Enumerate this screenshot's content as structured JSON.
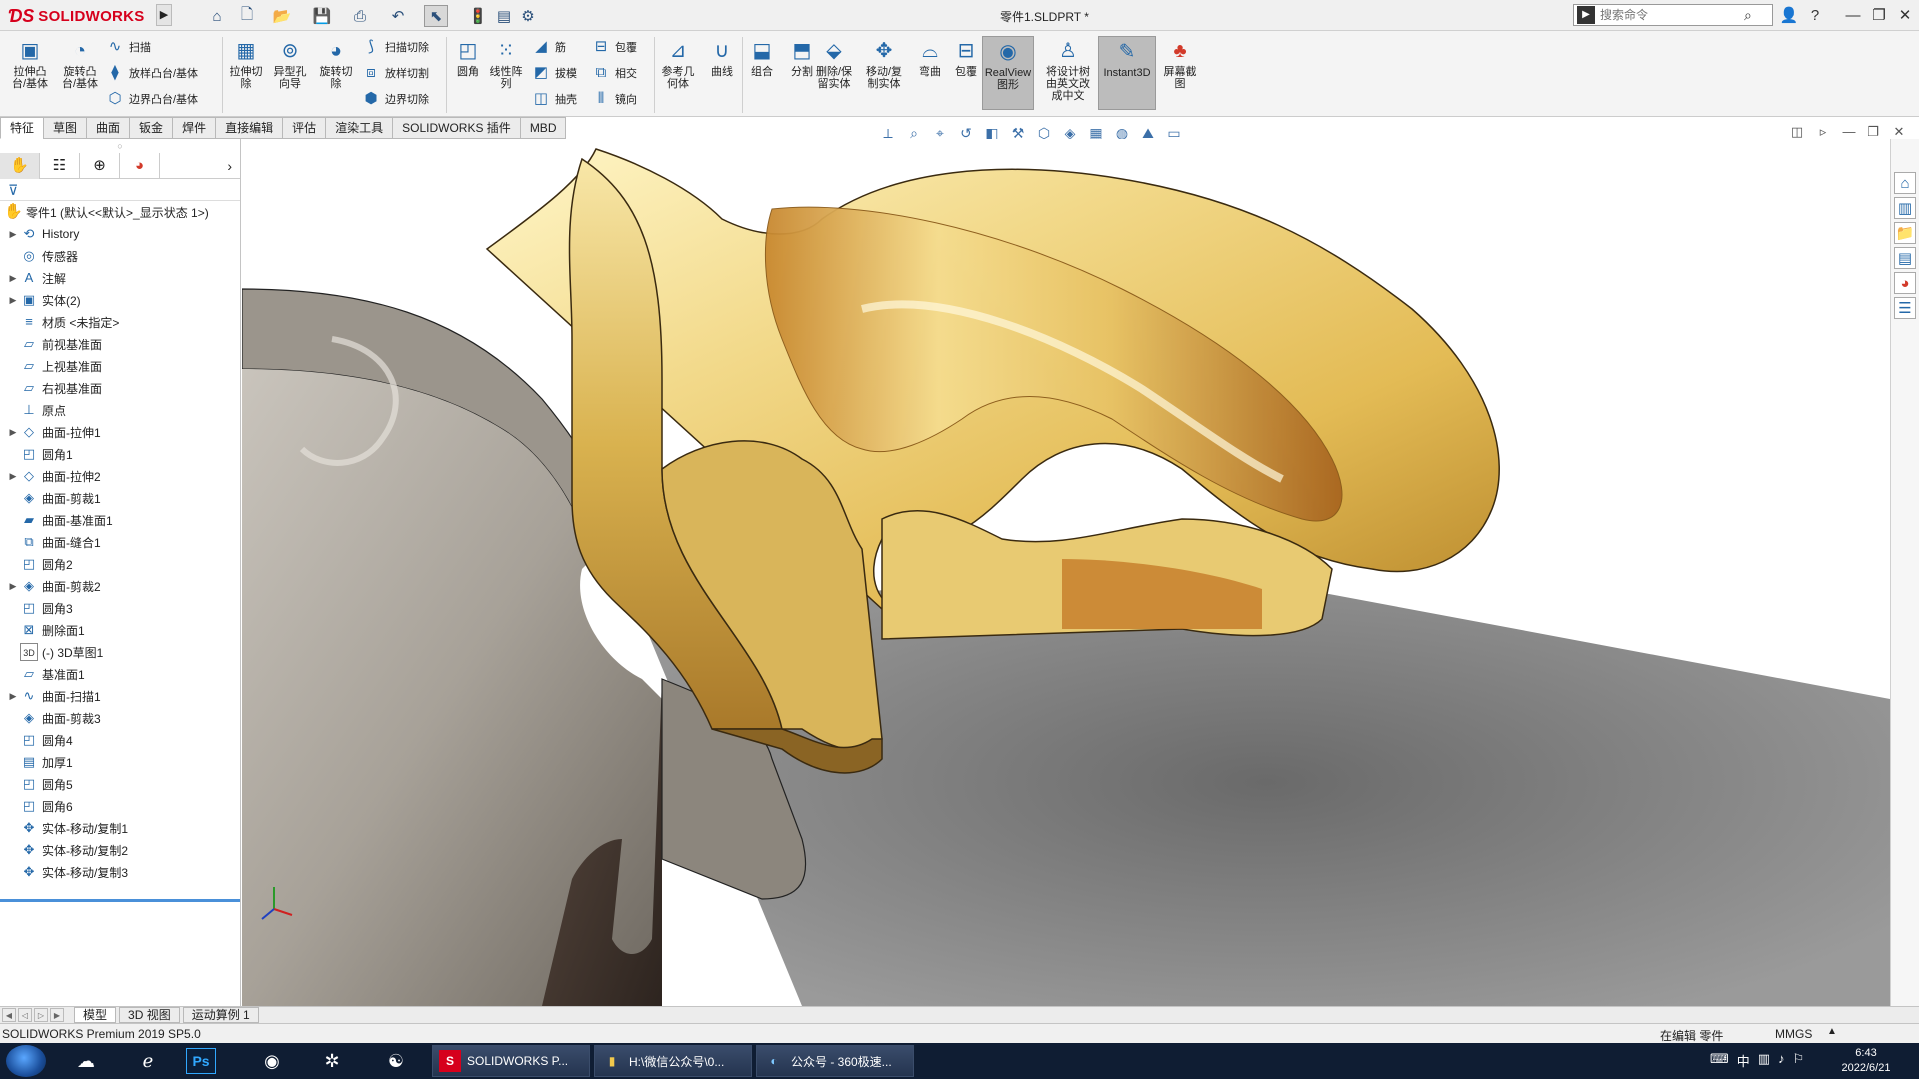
{
  "titlebar": {
    "brand": "SOLIDWORKS",
    "document_title": "零件1.SLDPRT *",
    "search_placeholder": "搜索命令"
  },
  "ribbon": {
    "extrude_boss": "拉伸凸\n台/基体",
    "revolve_boss": "旋转凸\n台/基体",
    "sweep": "扫描",
    "loft": "放样凸台/基体",
    "boundary_boss": "边界凸台/基体",
    "extrude_cut": "拉伸切\n除",
    "hole_wizard": "异型孔\n向导",
    "revolve_cut": "旋转切\n除",
    "swept_cut": "扫描切除",
    "lofted_cut": "放样切割",
    "boundary_cut": "边界切除",
    "fillet": "圆角",
    "linear_pattern": "线性阵\n列",
    "rib": "筋",
    "draft": "拔模",
    "shell": "抽壳",
    "wrap": "包覆",
    "intersect": "相交",
    "mirror": "镜向",
    "ref_geometry": "参考几\n何体",
    "curves": "曲线",
    "combine": "组合",
    "split": "分割",
    "delete_keep": "删除/保\n留实体",
    "move_copy": "移动/复\n制实体",
    "flex": "弯曲",
    "wrap2": "包覆",
    "realview": "RealView\n图形",
    "translate": "将设计树\n由英文改\n成中文",
    "instant3d": "Instant3D",
    "screenshot": "屏幕截\n图"
  },
  "command_tabs": [
    "特征",
    "草图",
    "曲面",
    "钣金",
    "焊件",
    "直接编辑",
    "评估",
    "渲染工具",
    "SOLIDWORKS 插件",
    "MBD"
  ],
  "tree": {
    "root": "零件1 (默认<<默认>_显示状态 1>)",
    "items": [
      {
        "label": "History",
        "icon": "history-icon",
        "expand": true
      },
      {
        "label": "传感器",
        "icon": "sensor-icon",
        "expand": false
      },
      {
        "label": "注解",
        "icon": "annotation-icon",
        "expand": true
      },
      {
        "label": "实体(2)",
        "icon": "solid-bodies-icon",
        "expand": true
      },
      {
        "label": "材质 <未指定>",
        "icon": "material-icon",
        "expand": false
      },
      {
        "label": "前视基准面",
        "icon": "plane-icon",
        "expand": false
      },
      {
        "label": "上视基准面",
        "icon": "plane-icon",
        "expand": false
      },
      {
        "label": "右视基准面",
        "icon": "plane-icon",
        "expand": false
      },
      {
        "label": "原点",
        "icon": "origin-icon",
        "expand": false
      },
      {
        "label": "曲面-拉伸1",
        "icon": "surface-extrude-icon",
        "expand": true
      },
      {
        "label": "圆角1",
        "icon": "fillet-icon",
        "expand": false
      },
      {
        "label": "曲面-拉伸2",
        "icon": "surface-extrude-icon",
        "expand": true
      },
      {
        "label": "曲面-剪裁1",
        "icon": "surface-trim-icon",
        "expand": false
      },
      {
        "label": "曲面-基准面1",
        "icon": "planar-surface-icon",
        "expand": false
      },
      {
        "label": "曲面-缝合1",
        "icon": "knit-icon",
        "expand": false
      },
      {
        "label": "圆角2",
        "icon": "fillet-icon",
        "expand": false
      },
      {
        "label": "曲面-剪裁2",
        "icon": "surface-trim-icon",
        "expand": true
      },
      {
        "label": "圆角3",
        "icon": "fillet-icon",
        "expand": false
      },
      {
        "label": "删除面1",
        "icon": "delete-face-icon",
        "expand": false
      },
      {
        "label": "(-) 3D草图1",
        "icon": "3d-sketch-icon",
        "expand": false
      },
      {
        "label": "基准面1",
        "icon": "plane-icon",
        "expand": false
      },
      {
        "label": "曲面-扫描1",
        "icon": "surface-sweep-icon",
        "expand": true
      },
      {
        "label": "曲面-剪裁3",
        "icon": "surface-trim-icon",
        "expand": false
      },
      {
        "label": "圆角4",
        "icon": "fillet-icon",
        "expand": false
      },
      {
        "label": "加厚1",
        "icon": "thicken-icon",
        "expand": false
      },
      {
        "label": "圆角5",
        "icon": "fillet-icon",
        "expand": false
      },
      {
        "label": "圆角6",
        "icon": "fillet-icon",
        "expand": false
      },
      {
        "label": "实体-移动/复制1",
        "icon": "move-copy-icon",
        "expand": false
      },
      {
        "label": "实体-移动/复制2",
        "icon": "move-copy-icon",
        "expand": false
      },
      {
        "label": "实体-移动/复制3",
        "icon": "move-copy-icon",
        "expand": false
      }
    ]
  },
  "bottom_tabs": [
    "模型",
    "3D 视图",
    "运动算例 1"
  ],
  "status": {
    "product": "SOLIDWORKS Premium 2019 SP5.0",
    "editing": "在编辑 零件",
    "units": "MMGS"
  },
  "taskbar": {
    "windows": [
      {
        "label": "SOLIDWORKS P...",
        "icon": "solidworks-icon"
      },
      {
        "label": "H:\\微信公众号\\0...",
        "icon": "folder-icon"
      },
      {
        "label": "公众号 - 360极速...",
        "icon": "browser-icon"
      }
    ],
    "time": "6:43",
    "date": "2022/6/21"
  },
  "colors": {
    "brand_red": "#d6001c",
    "gold_body": "#e8c85a",
    "steel_body": "#9c968c",
    "taskbar": "#0f1d33"
  }
}
